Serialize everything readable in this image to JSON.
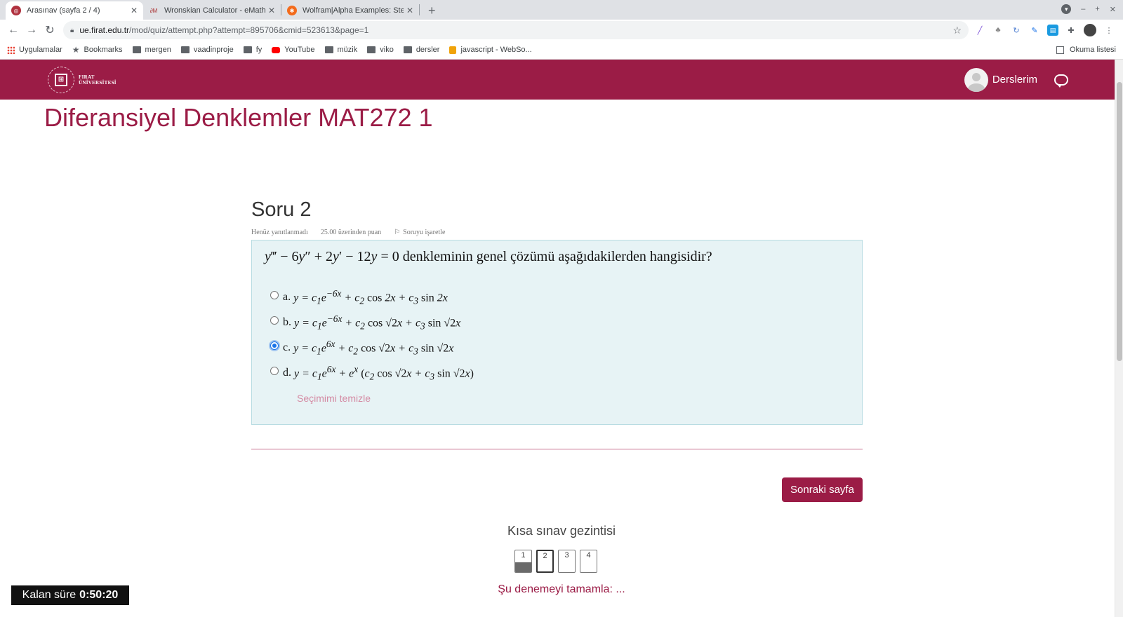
{
  "browser": {
    "tabs": [
      {
        "title": "Arasınav (sayfa 2 / 4)",
        "active": true
      },
      {
        "title": "Wronskian Calculator - eMathHelp",
        "active": false
      },
      {
        "title": "Wolfram|Alpha Examples: Step-by-Step",
        "active": false
      }
    ],
    "url_host": "ue.firat.edu.tr",
    "url_path": "/mod/quiz/attempt.php?attempt=895706&cmid=523613&page=1",
    "bookmarks": [
      {
        "label": "Uygulamalar",
        "icon": "apps-icon"
      },
      {
        "label": "Bookmarks",
        "icon": "star-icon"
      },
      {
        "label": "mergen",
        "icon": "folder-icon"
      },
      {
        "label": "vaadinproje",
        "icon": "folder-icon"
      },
      {
        "label": "fy",
        "icon": "folder-icon"
      },
      {
        "label": "YouTube",
        "icon": "youtube-icon"
      },
      {
        "label": "müzik",
        "icon": "folder-icon"
      },
      {
        "label": "viko",
        "icon": "folder-icon"
      },
      {
        "label": "dersler",
        "icon": "folder-icon"
      },
      {
        "label": "javascript - WebSo...",
        "icon": "java-icon"
      }
    ],
    "reading_list": "Okuma listesi"
  },
  "site": {
    "logo_line1": "FIRAT",
    "logo_line2": "ÜNİVERSİTESİ",
    "user_menu": "Derslerim",
    "brand_color": "#9b1c46"
  },
  "course_title": "Diferansiyel Denklemler MAT272 1",
  "question": {
    "number_label": "Soru 2",
    "status": "Henüz yanıtlanmadı",
    "points": "25.00 üzerinden puan",
    "flag_label": "Soruyu işaretle",
    "text": "denkleminin genel çözümü aşağıdakilerden hangisidir?",
    "options": [
      {
        "letter": "a.",
        "selected": false
      },
      {
        "letter": "b.",
        "selected": false
      },
      {
        "letter": "c.",
        "selected": true
      },
      {
        "letter": "d.",
        "selected": false
      }
    ],
    "clear_choice": "Seçimimi temizle"
  },
  "next_page": "Sonraki sayfa",
  "quiz_nav": {
    "title": "Kısa sınav gezintisi",
    "pages": [
      {
        "label": "1",
        "state": "answered"
      },
      {
        "label": "2",
        "state": "current"
      },
      {
        "label": "3",
        "state": "unanswered"
      },
      {
        "label": "4",
        "state": "unanswered"
      }
    ],
    "finish": "Şu denemeyi tamamla: ..."
  },
  "timer": {
    "label": "Kalan süre",
    "value": "0:50:20"
  }
}
